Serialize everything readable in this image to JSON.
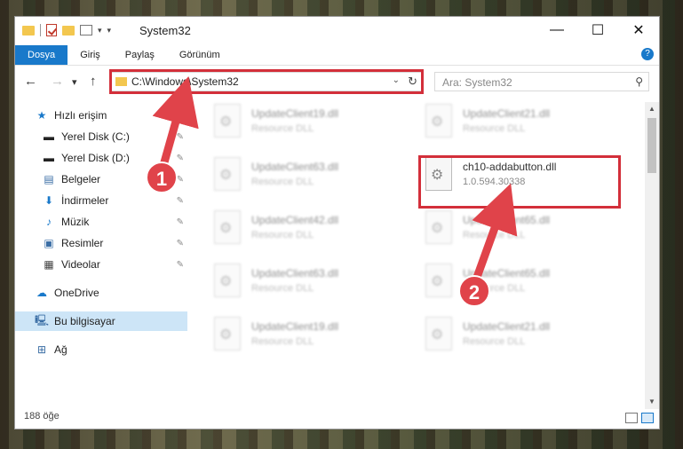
{
  "window": {
    "title": "System32"
  },
  "ribbon": {
    "tabs": [
      "Dosya",
      "Giriş",
      "Paylaş",
      "Görünüm"
    ]
  },
  "nav": {
    "address": "C:\\Windows\\System32",
    "search_placeholder": "Ara: System32"
  },
  "sidebar": {
    "items": [
      {
        "label": "Hızlı erişim",
        "icon": "star-icon"
      },
      {
        "label": "Yerel Disk (C:)",
        "icon": "drive-icon"
      },
      {
        "label": "Yerel Disk (D:)",
        "icon": "drive-icon"
      },
      {
        "label": "Belgeler",
        "icon": "document-icon"
      },
      {
        "label": "İndirmeler",
        "icon": "download-icon"
      },
      {
        "label": "Müzik",
        "icon": "music-icon"
      },
      {
        "label": "Resimler",
        "icon": "pictures-icon"
      },
      {
        "label": "Videolar",
        "icon": "video-icon"
      },
      {
        "label": "OneDrive",
        "icon": "cloud-icon"
      },
      {
        "label": "Bu bilgisayar",
        "icon": "computer-icon"
      },
      {
        "label": "Ağ",
        "icon": "network-icon"
      }
    ]
  },
  "files": [
    {
      "name": "UpdateClient19.dll",
      "type": "Resource DLL"
    },
    {
      "name": "UpdateClient21.dll",
      "type": "Resource DLL"
    },
    {
      "name": "UpdateClient63.dll",
      "type": "Resource DLL"
    },
    {
      "name": "ch10-addabutton.dll",
      "type": "1.0.594.30338"
    },
    {
      "name": "UpdateClient42.dll",
      "type": "Resource DLL"
    },
    {
      "name": "UpdateClient65.dll",
      "type": "Resource DLL"
    },
    {
      "name": "UpdateClient63.dll",
      "type": "Resource DLL"
    },
    {
      "name": "UpdateClient65.dll",
      "type": "Resource DLL"
    },
    {
      "name": "UpdateClient19.dll",
      "type": "Resource DLL"
    },
    {
      "name": "UpdateClient21.dll",
      "type": "Resource DLL"
    }
  ],
  "status": {
    "count": "188 öğe"
  },
  "callouts": {
    "one": "1",
    "two": "2"
  },
  "colors": {
    "accent": "#1979ca",
    "highlight": "#d32f3a",
    "badge": "#e0434a"
  }
}
